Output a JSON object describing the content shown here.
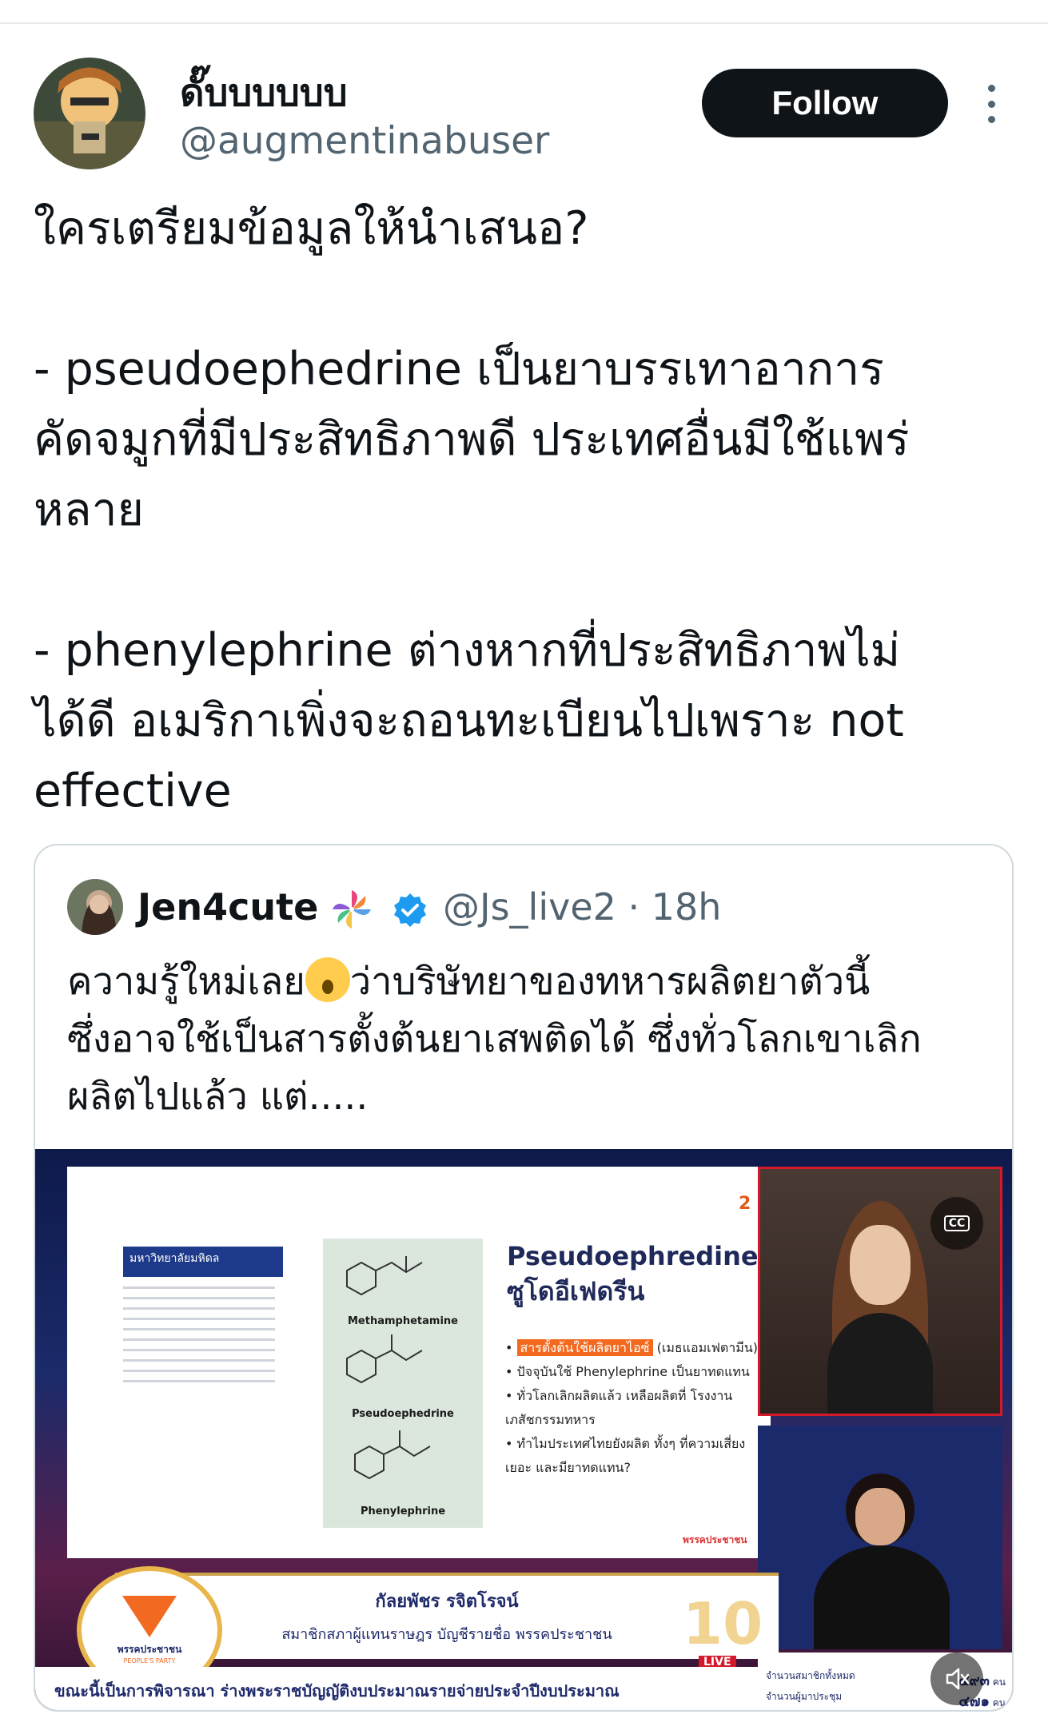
{
  "tweet": {
    "author": {
      "display_name": "ดั๊บบบบบบ",
      "handle": "@augmentinabuser"
    },
    "follow_label": "Follow",
    "text_lines": [
      "ใครเตรียมข้อมูลให้นำเสนอ?",
      "",
      "- pseudoephedrine เป็นยาบรรเทาอาการ",
      "คัดจมูกที่มีประสิทธิภาพดี ประเทศอื่นมีใช้แพร่",
      "หลาย",
      "",
      "- phenylephrine ต่างหากที่ประสิทธิภาพไม่",
      "ได้ดี อเมริกาเพิ่งจะถอนทะเบียนไปเพราะ not",
      "effective"
    ]
  },
  "quote": {
    "name": "Jen4cute",
    "meta": "@Js_live2 · 18h",
    "text_line1_a": "ความรู้ใหม่เลย",
    "text_line1_b": "ว่าบริษัทยาของทหารผลิตยาตัวนี้",
    "text_line2": "ซึ่งอาจใช้เป็นสารตั้งต้นยาเสพติดได้ ซึ่งทั่วโลกเขาเลิก",
    "text_line3": "ผลิตไปแล้ว แต่.....",
    "video": {
      "slide": {
        "number": "2",
        "university": "มหาวิทยาลัยมหิดล",
        "title_en": "Pseudoephredine",
        "title_th": "ซูโดอีเฟดรีน",
        "structures": [
          "Methamphetamine",
          "Pseudoephedrine",
          "Phenylephrine"
        ],
        "bullet1_highlight": "สารตั้งต้นใช้ผลิตยาไอซ์",
        "bullet1_rest": " (เมธแอมเฟตามีน)",
        "bullet2": "ปัจจุบันใช้ Phenylephrine เป็นยาทดแทน",
        "bullet3": "ทั่วโลกเลิกผลิตแล้ว เหลือผลิตที่ โรงงานเภสัชกรรมทหาร",
        "bullet4": "ทำไมประเทศไทยยังผลิต ทั้งๆ ที่ความเสี่ยงเยอะ และมียาทดแทน?",
        "footer_logo": "พรรคประชาชน"
      },
      "speaker_name": "กัลยพัชร รจิตโรจน์",
      "speaker_role": "สมาชิกสภาผู้แทนราษฎร บัญชีรายชื่อ พรรคประชาชน",
      "party_name": "พรรคประชาชน",
      "party_name_en": "PEOPLE'S PARTY",
      "ten": "10",
      "live": "LIVE",
      "ticker": "ขณะนี้เป็นการพิจารณา ร่างพระราชบัญญัติงบประมาณรายจ่ายประจำปีงบประมาณ",
      "vote_total_label": "จำนวนสมาชิกทั้งหมด",
      "vote_total_value": "๔๙๓",
      "vote_present_label": "จำนวนผู้มาประชุม",
      "vote_present_value": "๔๗๑",
      "vote_unit": "คน",
      "cc_label": "CC"
    }
  },
  "colors": {
    "text": "#0f1419",
    "secondary": "#536471",
    "follow_bg": "#0f1419",
    "verified": "#1d9bf0",
    "border": "#cfd9de"
  },
  "icons": [
    "more-vertical-icon",
    "verified-badge-icon",
    "pinwheel-icon",
    "closed-captions-icon",
    "mute-icon"
  ]
}
